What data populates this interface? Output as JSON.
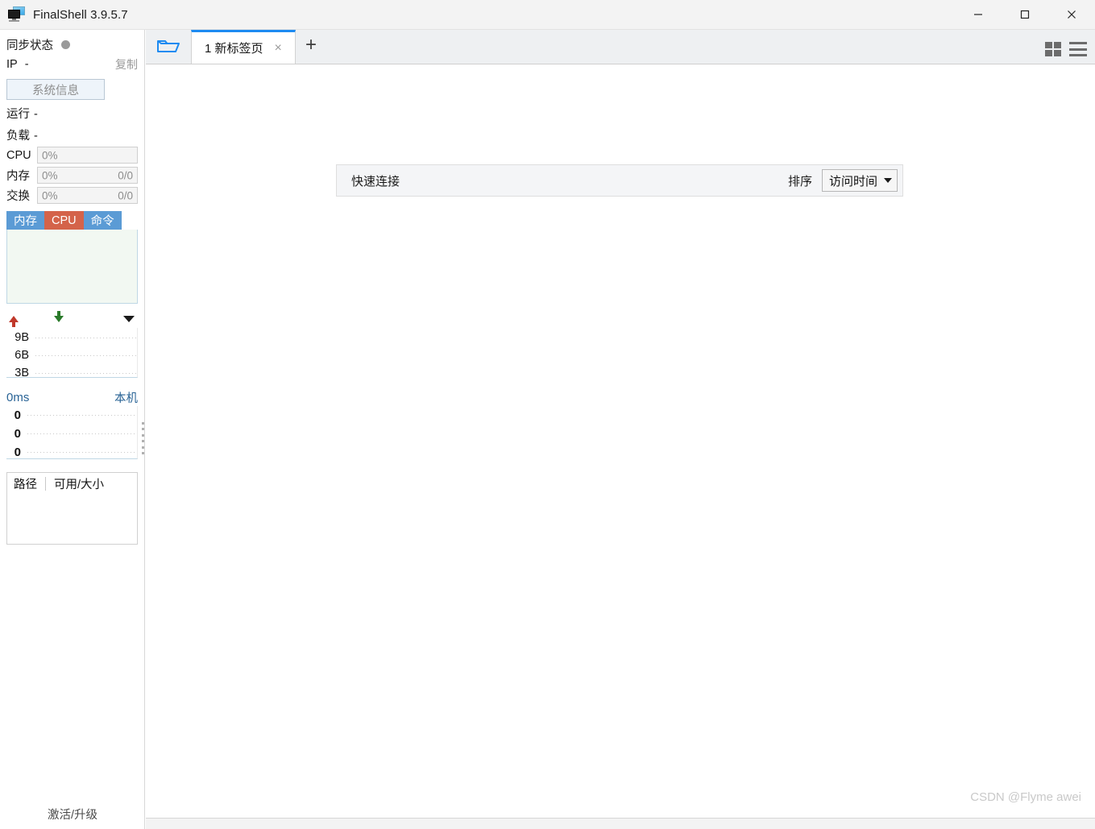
{
  "window": {
    "title": "FinalShell 3.9.5.7",
    "icon": "monitor-icon",
    "minimize": "minimize-icon",
    "maximize": "maximize-icon",
    "close": "close-icon"
  },
  "sidebar": {
    "sync": {
      "label": "同步状态",
      "status_color": "#9a9a9a"
    },
    "ip": {
      "label": "IP",
      "value": "-",
      "copy_label": "复制"
    },
    "sysinfo_button": "系统信息",
    "uptime": {
      "label": "运行",
      "value": "-"
    },
    "load": {
      "label": "负载",
      "value": "-"
    },
    "meters": [
      {
        "label": "CPU",
        "percent": "0%",
        "amount": ""
      },
      {
        "label": "内存",
        "percent": "0%",
        "amount": "0/0"
      },
      {
        "label": "交换",
        "percent": "0%",
        "amount": "0/0"
      }
    ],
    "mini_tabs": [
      {
        "label": "内存",
        "active": false
      },
      {
        "label": "CPU",
        "active": true
      },
      {
        "label": "命令",
        "active": false
      }
    ],
    "network": {
      "upload_icon": "arrow-up-icon",
      "download_icon": "arrow-down-icon",
      "menu_icon": "caret-down-icon",
      "scale_labels": [
        "9B",
        "6B",
        "3B"
      ]
    },
    "latency": {
      "value": "0ms",
      "host": "本机",
      "scale_labels": [
        "0",
        "0",
        "0"
      ]
    },
    "disk": {
      "columns": [
        "路径",
        "可用/大小"
      ],
      "rows": []
    },
    "activate": "激活/升级"
  },
  "tabbar": {
    "folder_icon": "open-folder-icon",
    "tabs": [
      {
        "title": "1 新标签页",
        "close": "×",
        "active": true
      }
    ],
    "new_tab": "+",
    "grid_icon": "grid-view-icon",
    "menu_icon": "hamburger-menu-icon"
  },
  "main": {
    "quick_connect": {
      "title": "快速连接",
      "sort_label": "排序",
      "sort_value": "访问时间",
      "caret": "caret-down-icon"
    },
    "watermark": "CSDN @Flyme awei"
  },
  "colors": {
    "accent_blue": "#1d8bf1",
    "tab_blue": "#5b9bd5",
    "tab_active_red": "#d4634a",
    "link_blue": "#2a6496",
    "upload_red": "#c0392b",
    "download_green": "#2a7a2a"
  }
}
